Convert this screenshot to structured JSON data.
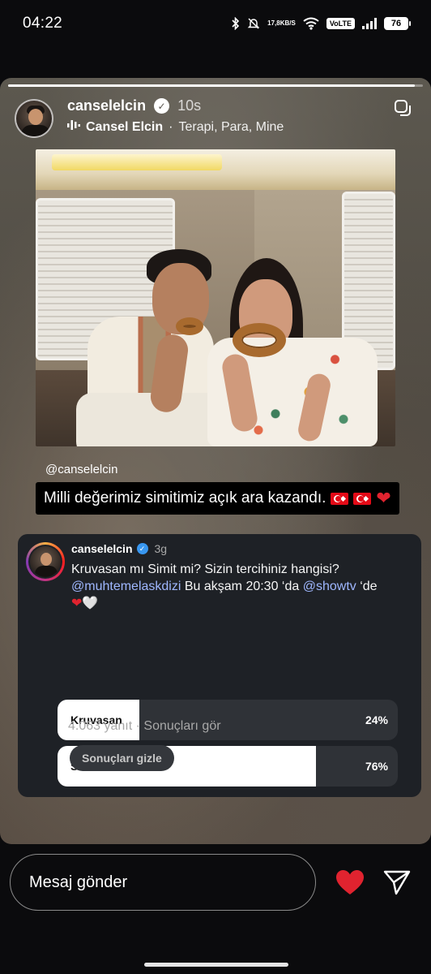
{
  "status_bar": {
    "time": "04:22",
    "net_speed_value": "17,8",
    "net_speed_unit": "KB/S",
    "volte": "VoLTE",
    "battery": "76"
  },
  "story": {
    "progress": 0.98,
    "username": "canselelcin",
    "time_ago": "10s",
    "music_artist": "Cansel Elcin",
    "music_separator": "·",
    "music_track": "Terapi, Para, Mine",
    "mention": "@canselelcin",
    "caption": "Milli değerimiz simitimiz açık ara kazandı."
  },
  "poll": {
    "username": "canselelcin",
    "time_ago": "3g",
    "question_1": "Kruvasan mı Simit mi? Sizin tercihiniz hangisi?",
    "mention_1": "@muhtemelaskdizi",
    "question_2": " Bu akşam 20:30 ‘da ",
    "mention_2": "@showtv",
    "question_3": " ‘de",
    "options": [
      {
        "label": "Kruvasan",
        "percent_label": "24%",
        "fraction": 0.24
      },
      {
        "label": "Simit",
        "percent_label": "76%",
        "fraction": 0.76
      }
    ],
    "meta": "4.063 yanıt · Sonuçları gör",
    "hide_button": "Sonuçları gizle"
  },
  "bottom_bar": {
    "message_placeholder": "Mesaj gönder"
  },
  "icons": {
    "like": "heart-icon",
    "send": "send-icon",
    "more": "more-icon"
  },
  "colors": {
    "like_heart": "#e0232f",
    "verified_blue": "#3897f0",
    "link": "#9fb7ff"
  }
}
